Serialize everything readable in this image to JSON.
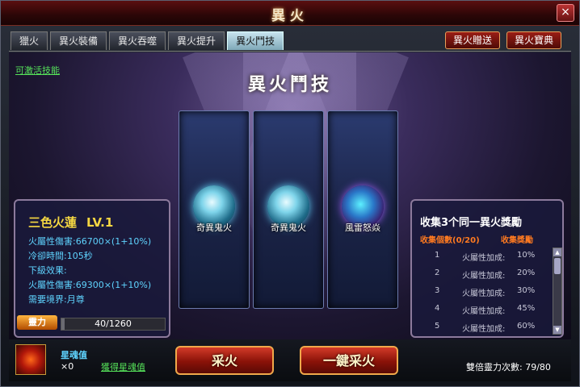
{
  "window": {
    "title": "異火",
    "close_label": "×"
  },
  "tabs": [
    {
      "label": "獵火",
      "active": false
    },
    {
      "label": "異火裝備",
      "active": false
    },
    {
      "label": "異火吞噬",
      "active": false
    },
    {
      "label": "異火提升",
      "active": false
    },
    {
      "label": "異火鬥技",
      "active": true
    }
  ],
  "top_buttons": {
    "gift": "異火贈送",
    "codex": "異火寶典"
  },
  "stage": {
    "title": "異火鬥技",
    "skill_link": "可激活技能",
    "cards": [
      {
        "label": "奇異鬼火",
        "icon": "skull-fire-icon"
      },
      {
        "label": "奇異鬼火",
        "icon": "skull-fire-icon"
      },
      {
        "label": "風雷怒焱",
        "icon": "storm-fire-icon"
      }
    ]
  },
  "skill_panel": {
    "name": "三色火蓮",
    "level": "LV.1",
    "damage": "火屬性傷害:66700×(1+10%)",
    "cooldown": "冷卻時間:105秒",
    "next_label": "下級效果:",
    "next_damage": "火屬性傷害:69300×(1+10%)",
    "requirement": "需要境界:月尊",
    "spirit_label": "靈力",
    "spirit_value": "40/1260",
    "spirit_fraction": 0.032
  },
  "reward_panel": {
    "title": "收集3个同一異火獎勵",
    "col_count": "收集個數(0/20)",
    "col_reward": "收集獎勵",
    "rows": [
      {
        "n": "1",
        "text": "火屬性加成:",
        "value": "10%"
      },
      {
        "n": "2",
        "text": "火屬性加成:",
        "value": "20%"
      },
      {
        "n": "3",
        "text": "火屬性加成:",
        "value": "30%"
      },
      {
        "n": "4",
        "text": "火屬性加成:",
        "value": "45%"
      },
      {
        "n": "5",
        "text": "火屬性加成:",
        "value": "60%"
      }
    ]
  },
  "bottom": {
    "soul_label": "星魂值",
    "soul_count": "×0",
    "get_soul": "獲得星魂值",
    "collect_button": "采火",
    "one_click_button": "一鍵采火",
    "double_spirit": "雙倍靈力次數: 79/80"
  },
  "colors": {
    "accent": "#f5d742",
    "link": "#56e35a",
    "stat": "#5fd4ff",
    "button": "#8a1208"
  }
}
